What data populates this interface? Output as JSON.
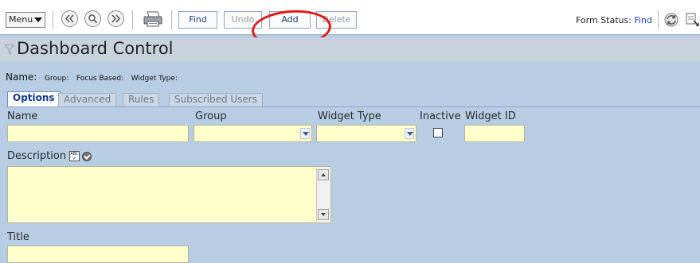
{
  "toolbar": {
    "menu_label": "Menu",
    "find_label": "Find",
    "undo_label": "Undo",
    "add_label": "Add",
    "delete_label": "Delete",
    "form_status_label": "Form Status:",
    "form_status_value": "Find",
    "colors": {
      "status_value": "#1f3fc7",
      "highlight_ring": "#e01a1a"
    }
  },
  "header": {
    "title": "Dashboard Control"
  },
  "name_row": {
    "name_label": "Name:",
    "group_label": "Group:",
    "group_value": "Focus Based:",
    "widget_type_label": "Widget Type:"
  },
  "tabs": [
    {
      "label": "Options",
      "active": true
    },
    {
      "label": "Advanced",
      "active": false
    },
    {
      "label": "Rules",
      "active": false
    },
    {
      "label": "Subscribed Users",
      "active": false
    }
  ],
  "form": {
    "name_label": "Name",
    "name_value": "",
    "group_label": "Group",
    "group_value": "",
    "widget_type_label": "Widget Type",
    "widget_type_value": "",
    "inactive_label": "Inactive",
    "inactive_checked": false,
    "widget_id_label": "Widget ID",
    "widget_id_value": "",
    "description_label": "Description",
    "description_value": "",
    "title_label": "Title",
    "title_value": ""
  },
  "icons": {
    "nav": [
      "first-record-icon",
      "search-icon",
      "last-record-icon"
    ],
    "print": "print-icon",
    "refresh": "refresh-icon",
    "other": "record-navigator-icon",
    "filter": "funnel-icon",
    "spellcheck": "spellcheck-icon",
    "check": "check-circle-icon"
  }
}
